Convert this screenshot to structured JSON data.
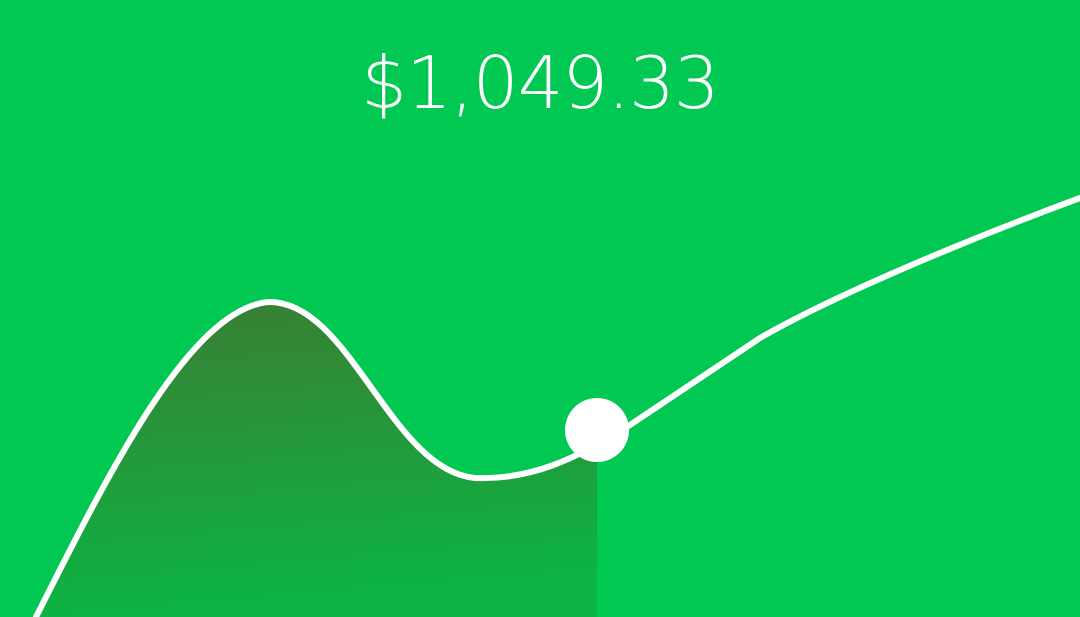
{
  "balance": {
    "amount": "$1,049.33"
  },
  "colors": {
    "background": "#00C853",
    "line": "#FFFFFF",
    "fill_top": "#3B7D33",
    "fill_bottom": "#0CB443"
  }
}
